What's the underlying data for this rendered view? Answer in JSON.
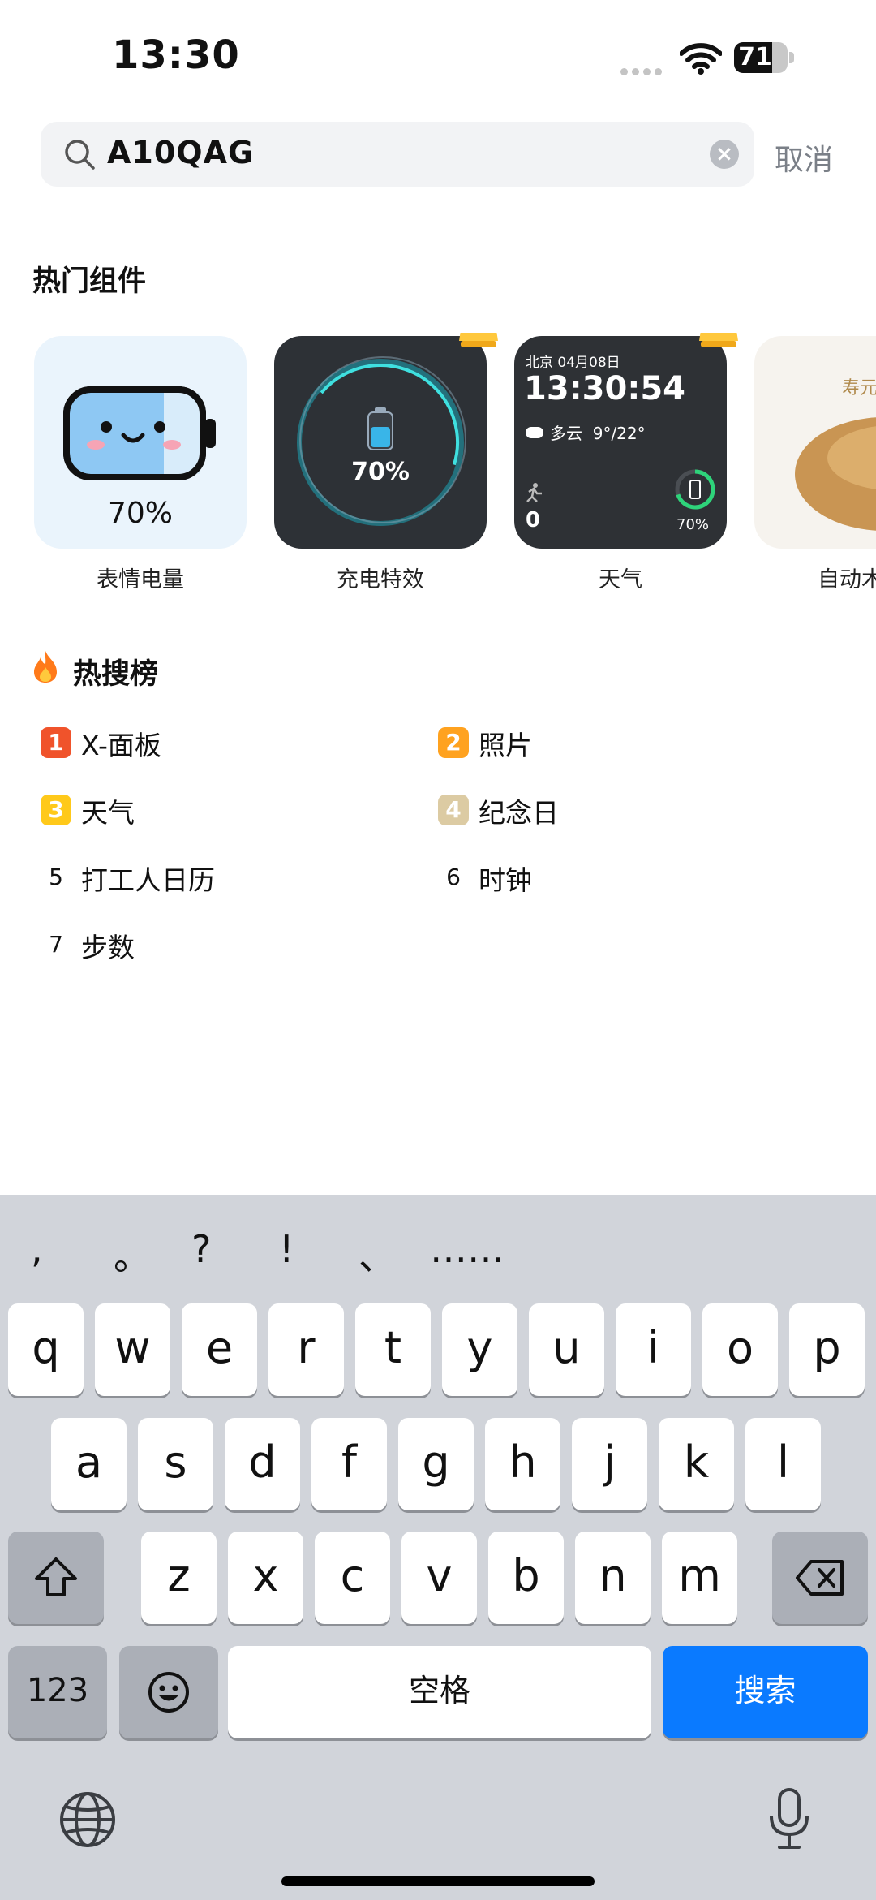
{
  "status_bar": {
    "time": "13:30",
    "battery": "71",
    "battery_level_pct": 71
  },
  "search": {
    "query": "A10QAG",
    "cancel_label": "取消"
  },
  "widgets_section": {
    "title": "热门组件",
    "items": [
      {
        "label": "表情电量",
        "value": "70%"
      },
      {
        "label": "充电特效",
        "value": "70%"
      },
      {
        "label": "天气",
        "city_date": "北京 04月08日",
        "clock": "13:30:54",
        "weather": "多云  9°/22°",
        "steps": "0",
        "battery": "70%"
      },
      {
        "label": "自动木",
        "badge": "寿元"
      }
    ]
  },
  "hot_search": {
    "title": "热搜榜",
    "items": [
      {
        "rank": "1",
        "label": "X-面板"
      },
      {
        "rank": "2",
        "label": "照片"
      },
      {
        "rank": "3",
        "label": "天气"
      },
      {
        "rank": "4",
        "label": "纪念日"
      },
      {
        "rank": "5",
        "label": "打工人日历"
      },
      {
        "rank": "6",
        "label": "时钟"
      },
      {
        "rank": "7",
        "label": "步数"
      }
    ],
    "rank_colors": [
      "#f0532b",
      "#ffa21f",
      "#ffc91a",
      "#dccba3"
    ]
  },
  "keyboard": {
    "symbols": [
      ",",
      "。",
      "?",
      "!",
      "、",
      "……"
    ],
    "row1": [
      "q",
      "w",
      "e",
      "r",
      "t",
      "y",
      "u",
      "i",
      "o",
      "p"
    ],
    "row2": [
      "a",
      "s",
      "d",
      "f",
      "g",
      "h",
      "j",
      "k",
      "l"
    ],
    "row3": [
      "z",
      "x",
      "c",
      "v",
      "b",
      "n",
      "m"
    ],
    "numbers_label": "123",
    "space_label": "空格",
    "search_label": "搜索",
    "accent_color": "#0a7aff"
  }
}
